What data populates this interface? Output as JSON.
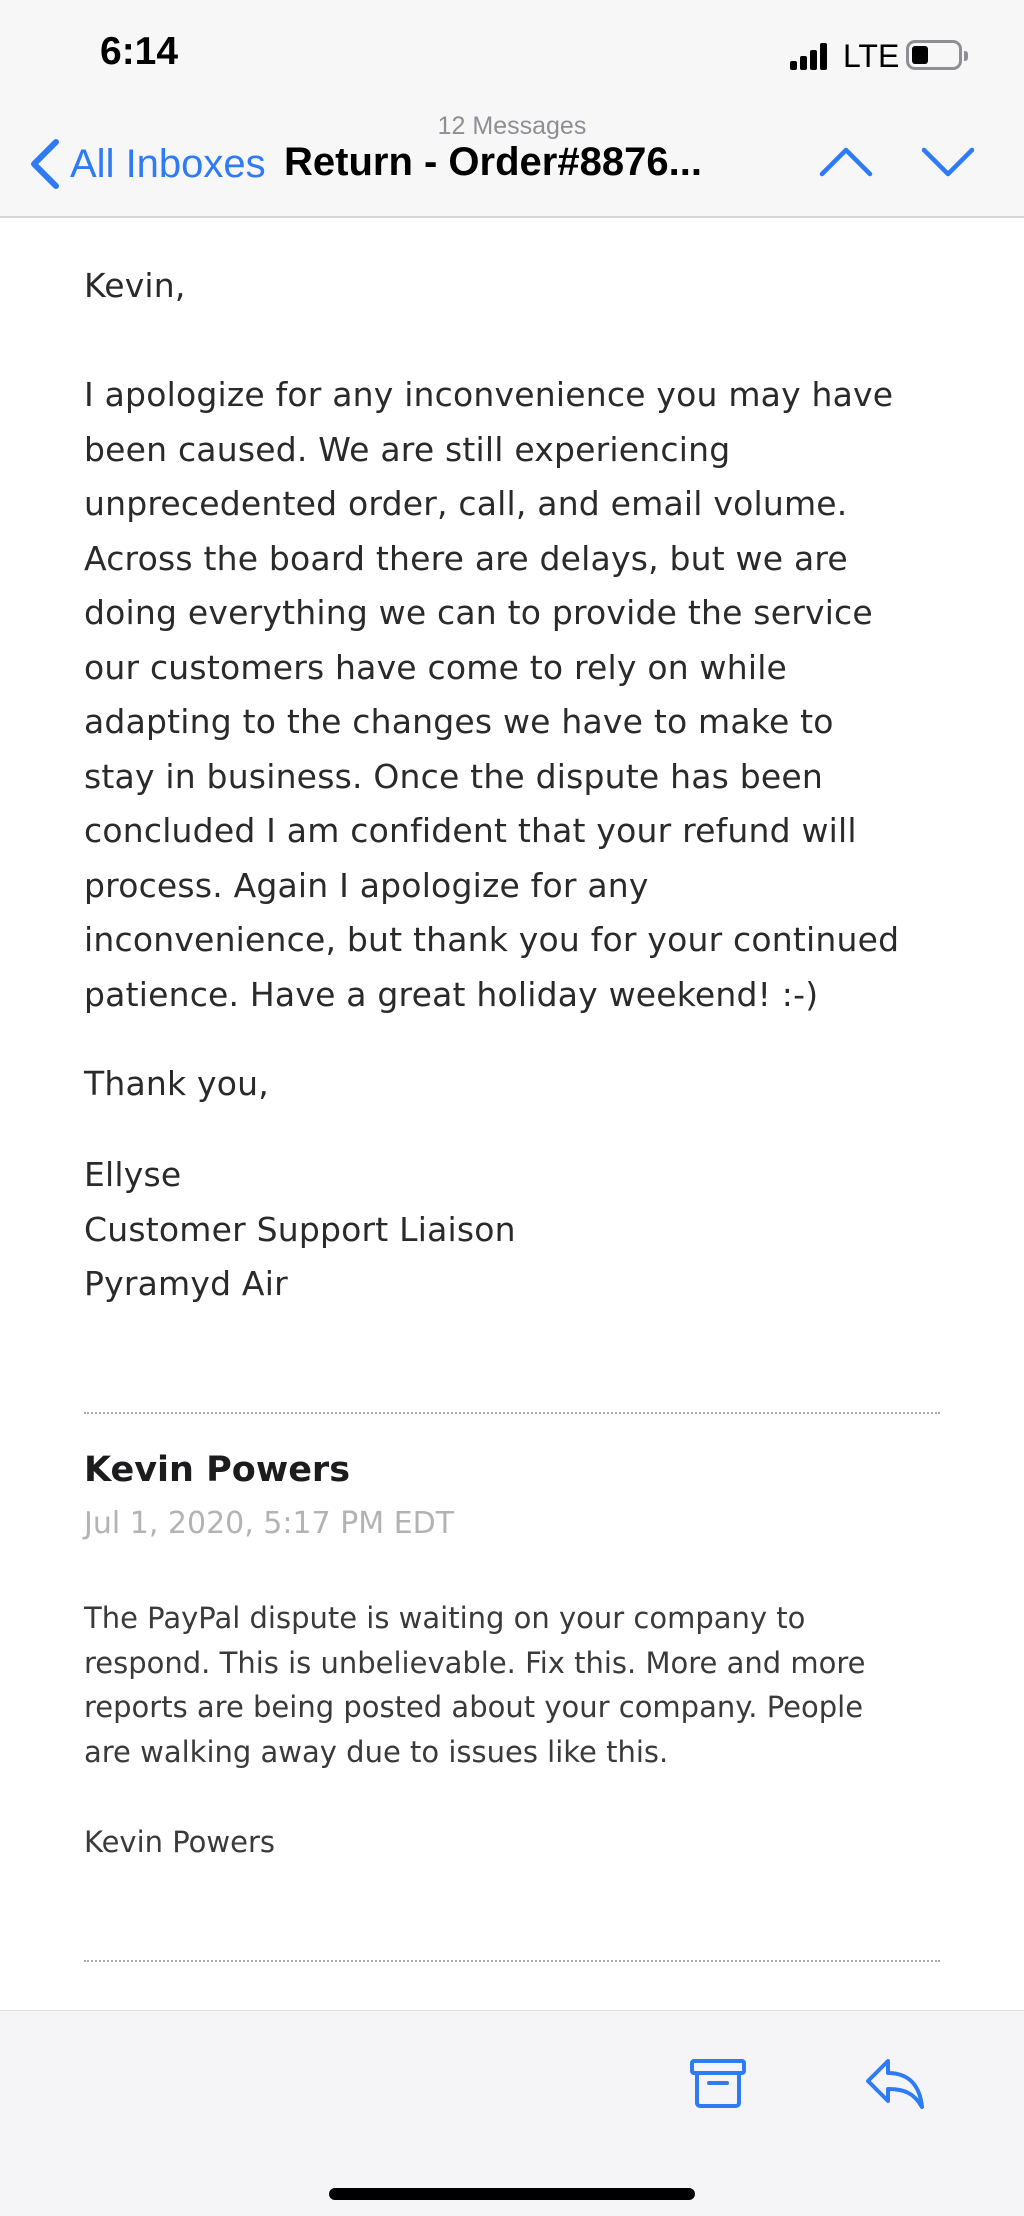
{
  "status_bar": {
    "time": "6:14",
    "network": "LTE"
  },
  "header": {
    "message_count": "12 Messages",
    "back_label": "All Inboxes",
    "subject": "Return - Order#8876..."
  },
  "colors": {
    "accent": "#2f7bf5",
    "body_text": "#2a2a2a",
    "muted_text": "#b3b3b3"
  },
  "message1": {
    "greeting": "Kevin,",
    "body": [
      "I apologize for any inconvenience you may have",
      "been caused. We are still experiencing",
      "unprecedented order, call, and email volume.",
      "Across the board there are delays, but we are",
      "doing everything we can to provide the service",
      "our customers have come to rely on while",
      "adapting to the changes we have to make to",
      "stay in business. Once the dispute has been",
      "concluded I am confident that your refund will",
      "process. Again I apologize for any",
      "inconvenience, but thank you for your continued",
      "patience. Have a great holiday weekend! :-)"
    ],
    "closing": "Thank you,",
    "signature": [
      "Ellyse",
      "Customer Support Liaison",
      "Pyramyd Air"
    ]
  },
  "message2": {
    "sender": "Kevin Powers",
    "date": "Jul 1, 2020, 5:17 PM EDT",
    "body": [
      "The PayPal dispute is waiting on your company to",
      "respond. This is unbelievable. Fix this. More and more",
      "reports are being posted about your company. People",
      "are walking away due to issues like this."
    ],
    "signature": "Kevin Powers"
  },
  "toolbar": {
    "icons": [
      "archive-icon",
      "reply-icon"
    ]
  }
}
